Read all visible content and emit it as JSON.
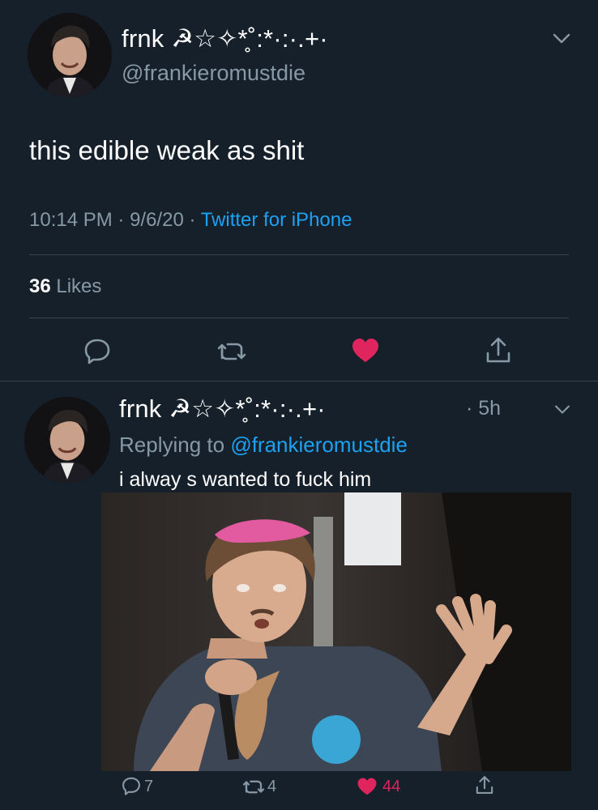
{
  "main_tweet": {
    "display_name": "frnk ☭☆✧*̥˚:*·:·.+·",
    "handle": "@frankieromustdie",
    "text": "this edible weak as shit",
    "time": "10:14 PM",
    "date": "9/6/20",
    "source": "Twitter for iPhone",
    "likes_count": "36",
    "likes_label": "Likes",
    "separator": " · "
  },
  "reply_tweet": {
    "display_name": "frnk ☭☆✧*̥˚:*·:·.+·",
    "time": "· 5h",
    "replying_label": "Replying to",
    "replying_to": "@frankieromustdie",
    "text": "i alway s wanted to fuck him",
    "reply_count": "7",
    "retweet_count": "4",
    "like_count": "44"
  },
  "colors": {
    "background": "#15202b",
    "text_primary": "#ffffff",
    "text_secondary": "#8899a6",
    "link": "#1da1f2",
    "like": "#e0245e",
    "divider": "#38444d"
  },
  "icons": [
    "chevron-down-icon",
    "reply-icon",
    "retweet-icon",
    "heart-icon",
    "share-icon"
  ]
}
